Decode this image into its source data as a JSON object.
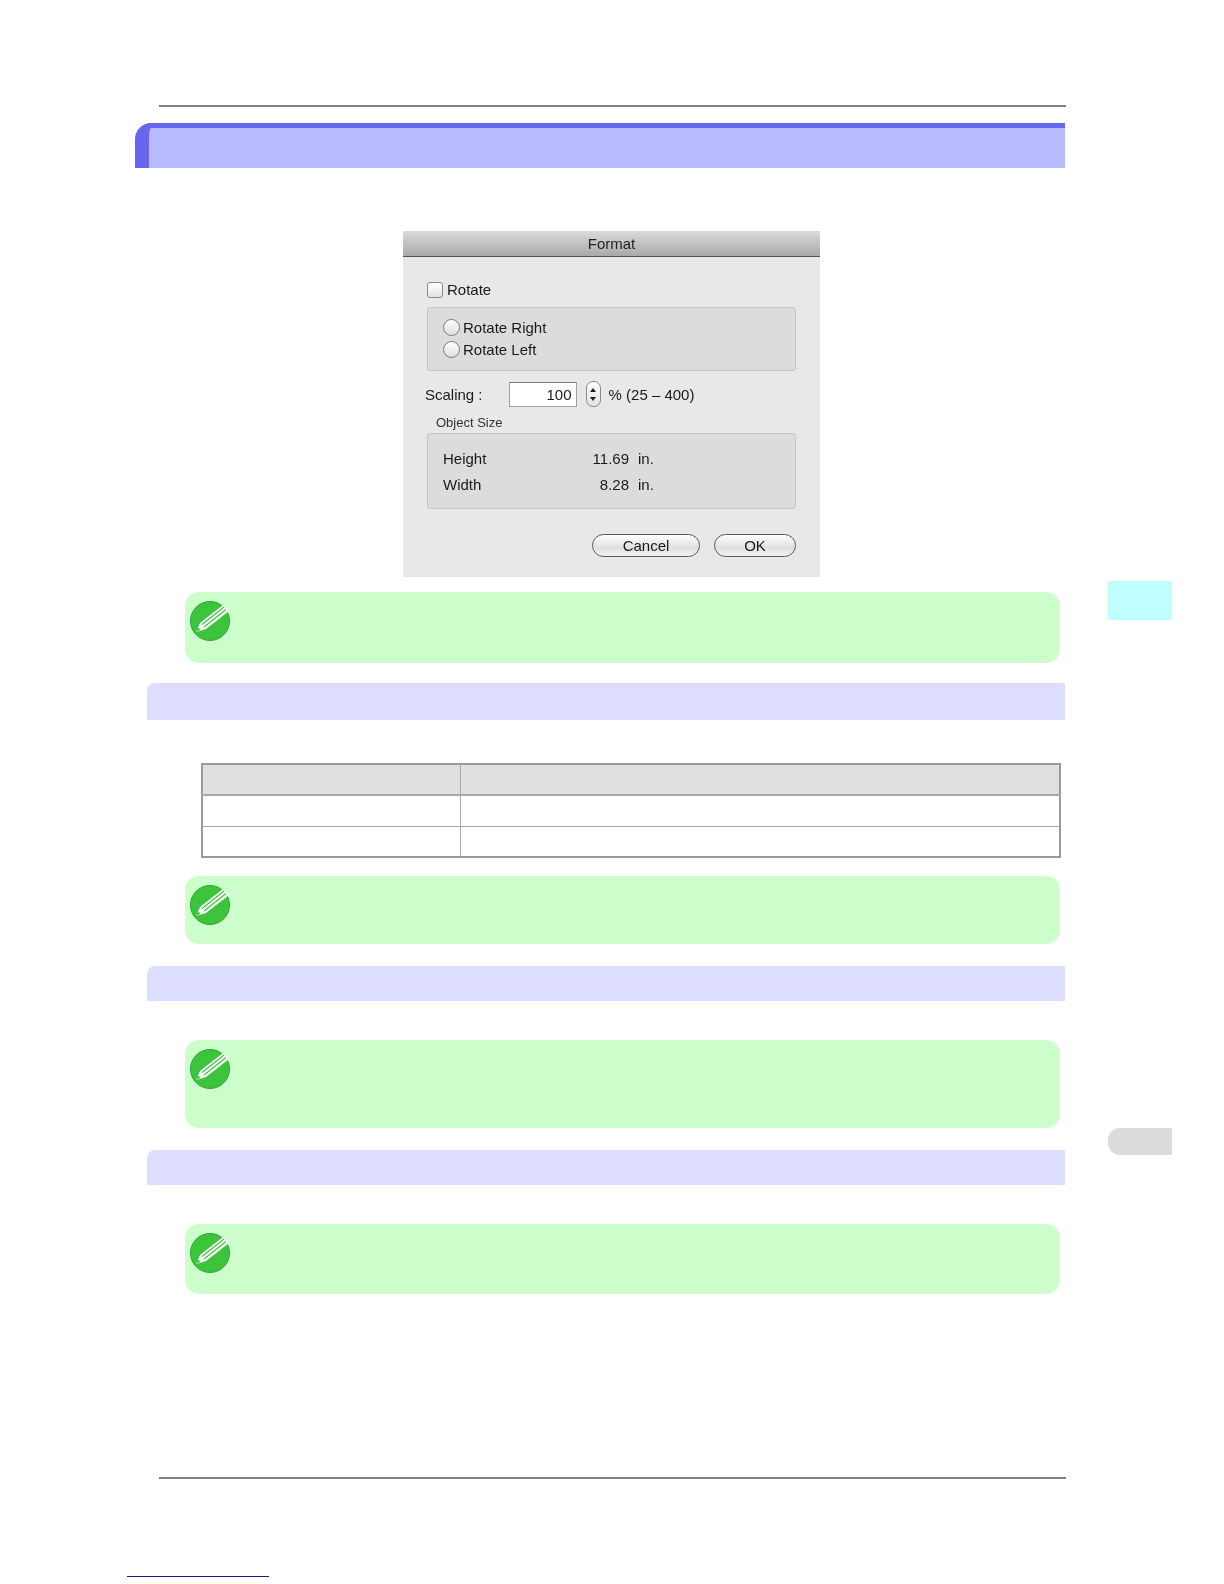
{
  "dialog": {
    "title": "Format",
    "rotate": {
      "label": "Rotate",
      "checked": false
    },
    "rotate_options": [
      {
        "label": "Rotate Right",
        "selected": false
      },
      {
        "label": "Rotate Left",
        "selected": false
      }
    ],
    "scaling": {
      "label": "Scaling :",
      "value": "100",
      "range": "% (25 – 400)"
    },
    "object_size": {
      "title": "Object Size",
      "rows": [
        {
          "label": "Height",
          "value": "11.69",
          "unit": "in."
        },
        {
          "label": "Width",
          "value": "8.28",
          "unit": "in."
        }
      ]
    },
    "buttons": [
      {
        "label": "Cancel"
      },
      {
        "label": "OK"
      }
    ]
  }
}
